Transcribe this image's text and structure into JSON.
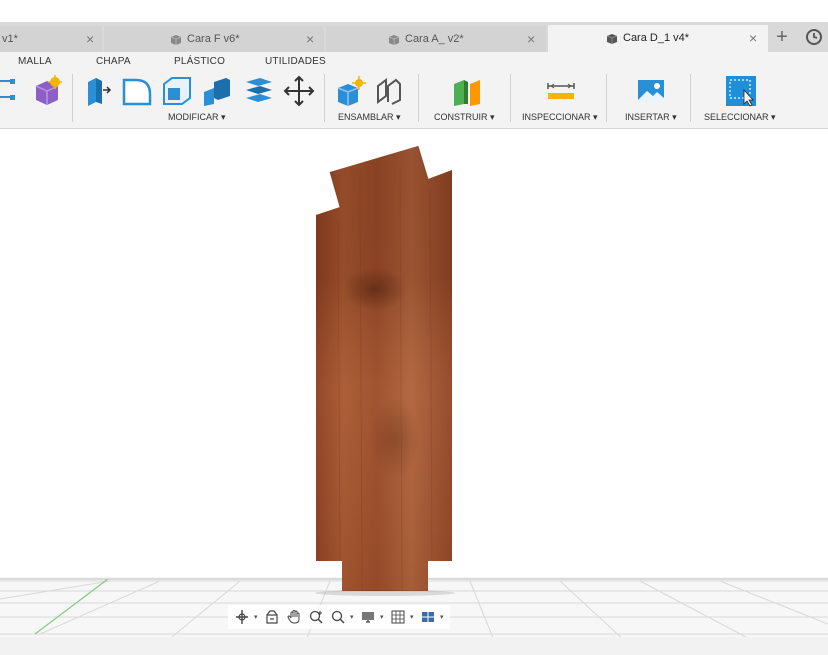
{
  "tabs": [
    {
      "label": "v1*",
      "active": false,
      "close": "×"
    },
    {
      "label": "Cara F v6*",
      "active": false,
      "close": "×"
    },
    {
      "label": "Cara A_ v2*",
      "active": false,
      "close": "×"
    },
    {
      "label": "Cara D_1 v4*",
      "active": true,
      "close": "×"
    }
  ],
  "toolbar": {
    "categories": [
      "MALLA",
      "CHAPA",
      "PLÁSTICO",
      "UTILIDADES"
    ],
    "groups": {
      "modificar": "MODIFICAR ▾",
      "ensamblar": "ENSAMBLAR ▾",
      "construir": "CONSTRUIR ▾",
      "inspeccionar": "INSPECCIONAR ▾",
      "insertar": "INSERTAR ▾",
      "seleccionar": "SELECCIONAR ▾"
    }
  },
  "colors": {
    "accent_blue": "#2b8fd6",
    "wood": "#9a4f2c",
    "tabbar": "#d9d9d9",
    "toolbar": "#f3f3f3"
  },
  "icons": {
    "new_tab": "plus-icon",
    "clock": "clock-icon",
    "navbar": [
      "orbit-icon",
      "look-at-icon",
      "pan-icon",
      "zoom-icon",
      "fit-icon",
      "display-settings-icon",
      "grid-settings-icon",
      "viewports-icon"
    ]
  }
}
